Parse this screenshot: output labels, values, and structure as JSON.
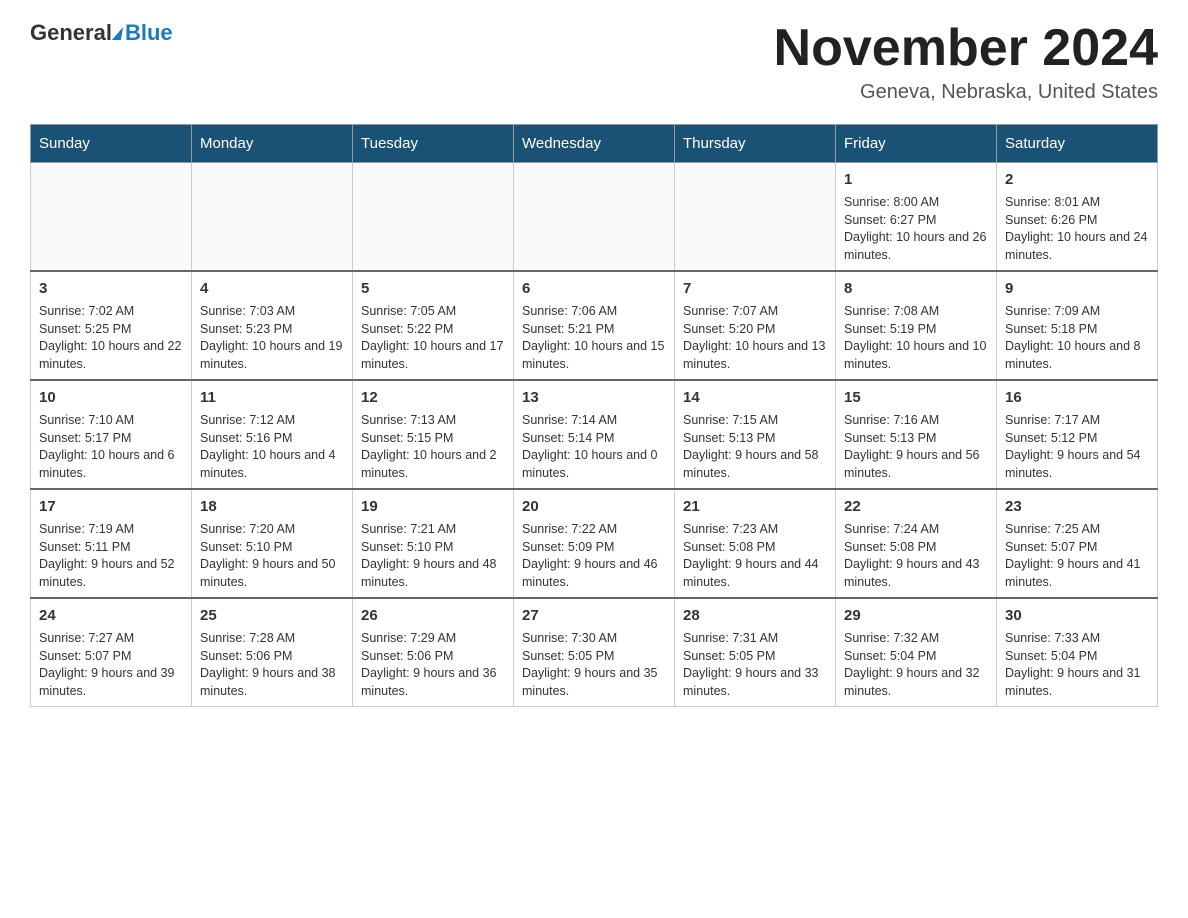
{
  "header": {
    "logo_general": "General",
    "logo_blue": "Blue",
    "main_title": "November 2024",
    "subtitle": "Geneva, Nebraska, United States"
  },
  "weekdays": [
    "Sunday",
    "Monday",
    "Tuesday",
    "Wednesday",
    "Thursday",
    "Friday",
    "Saturday"
  ],
  "weeks": [
    {
      "days": [
        {
          "number": "",
          "info": ""
        },
        {
          "number": "",
          "info": ""
        },
        {
          "number": "",
          "info": ""
        },
        {
          "number": "",
          "info": ""
        },
        {
          "number": "",
          "info": ""
        },
        {
          "number": "1",
          "info": "Sunrise: 8:00 AM\nSunset: 6:27 PM\nDaylight: 10 hours and 26 minutes."
        },
        {
          "number": "2",
          "info": "Sunrise: 8:01 AM\nSunset: 6:26 PM\nDaylight: 10 hours and 24 minutes."
        }
      ]
    },
    {
      "days": [
        {
          "number": "3",
          "info": "Sunrise: 7:02 AM\nSunset: 5:25 PM\nDaylight: 10 hours and 22 minutes."
        },
        {
          "number": "4",
          "info": "Sunrise: 7:03 AM\nSunset: 5:23 PM\nDaylight: 10 hours and 19 minutes."
        },
        {
          "number": "5",
          "info": "Sunrise: 7:05 AM\nSunset: 5:22 PM\nDaylight: 10 hours and 17 minutes."
        },
        {
          "number": "6",
          "info": "Sunrise: 7:06 AM\nSunset: 5:21 PM\nDaylight: 10 hours and 15 minutes."
        },
        {
          "number": "7",
          "info": "Sunrise: 7:07 AM\nSunset: 5:20 PM\nDaylight: 10 hours and 13 minutes."
        },
        {
          "number": "8",
          "info": "Sunrise: 7:08 AM\nSunset: 5:19 PM\nDaylight: 10 hours and 10 minutes."
        },
        {
          "number": "9",
          "info": "Sunrise: 7:09 AM\nSunset: 5:18 PM\nDaylight: 10 hours and 8 minutes."
        }
      ]
    },
    {
      "days": [
        {
          "number": "10",
          "info": "Sunrise: 7:10 AM\nSunset: 5:17 PM\nDaylight: 10 hours and 6 minutes."
        },
        {
          "number": "11",
          "info": "Sunrise: 7:12 AM\nSunset: 5:16 PM\nDaylight: 10 hours and 4 minutes."
        },
        {
          "number": "12",
          "info": "Sunrise: 7:13 AM\nSunset: 5:15 PM\nDaylight: 10 hours and 2 minutes."
        },
        {
          "number": "13",
          "info": "Sunrise: 7:14 AM\nSunset: 5:14 PM\nDaylight: 10 hours and 0 minutes."
        },
        {
          "number": "14",
          "info": "Sunrise: 7:15 AM\nSunset: 5:13 PM\nDaylight: 9 hours and 58 minutes."
        },
        {
          "number": "15",
          "info": "Sunrise: 7:16 AM\nSunset: 5:13 PM\nDaylight: 9 hours and 56 minutes."
        },
        {
          "number": "16",
          "info": "Sunrise: 7:17 AM\nSunset: 5:12 PM\nDaylight: 9 hours and 54 minutes."
        }
      ]
    },
    {
      "days": [
        {
          "number": "17",
          "info": "Sunrise: 7:19 AM\nSunset: 5:11 PM\nDaylight: 9 hours and 52 minutes."
        },
        {
          "number": "18",
          "info": "Sunrise: 7:20 AM\nSunset: 5:10 PM\nDaylight: 9 hours and 50 minutes."
        },
        {
          "number": "19",
          "info": "Sunrise: 7:21 AM\nSunset: 5:10 PM\nDaylight: 9 hours and 48 minutes."
        },
        {
          "number": "20",
          "info": "Sunrise: 7:22 AM\nSunset: 5:09 PM\nDaylight: 9 hours and 46 minutes."
        },
        {
          "number": "21",
          "info": "Sunrise: 7:23 AM\nSunset: 5:08 PM\nDaylight: 9 hours and 44 minutes."
        },
        {
          "number": "22",
          "info": "Sunrise: 7:24 AM\nSunset: 5:08 PM\nDaylight: 9 hours and 43 minutes."
        },
        {
          "number": "23",
          "info": "Sunrise: 7:25 AM\nSunset: 5:07 PM\nDaylight: 9 hours and 41 minutes."
        }
      ]
    },
    {
      "days": [
        {
          "number": "24",
          "info": "Sunrise: 7:27 AM\nSunset: 5:07 PM\nDaylight: 9 hours and 39 minutes."
        },
        {
          "number": "25",
          "info": "Sunrise: 7:28 AM\nSunset: 5:06 PM\nDaylight: 9 hours and 38 minutes."
        },
        {
          "number": "26",
          "info": "Sunrise: 7:29 AM\nSunset: 5:06 PM\nDaylight: 9 hours and 36 minutes."
        },
        {
          "number": "27",
          "info": "Sunrise: 7:30 AM\nSunset: 5:05 PM\nDaylight: 9 hours and 35 minutes."
        },
        {
          "number": "28",
          "info": "Sunrise: 7:31 AM\nSunset: 5:05 PM\nDaylight: 9 hours and 33 minutes."
        },
        {
          "number": "29",
          "info": "Sunrise: 7:32 AM\nSunset: 5:04 PM\nDaylight: 9 hours and 32 minutes."
        },
        {
          "number": "30",
          "info": "Sunrise: 7:33 AM\nSunset: 5:04 PM\nDaylight: 9 hours and 31 minutes."
        }
      ]
    }
  ]
}
